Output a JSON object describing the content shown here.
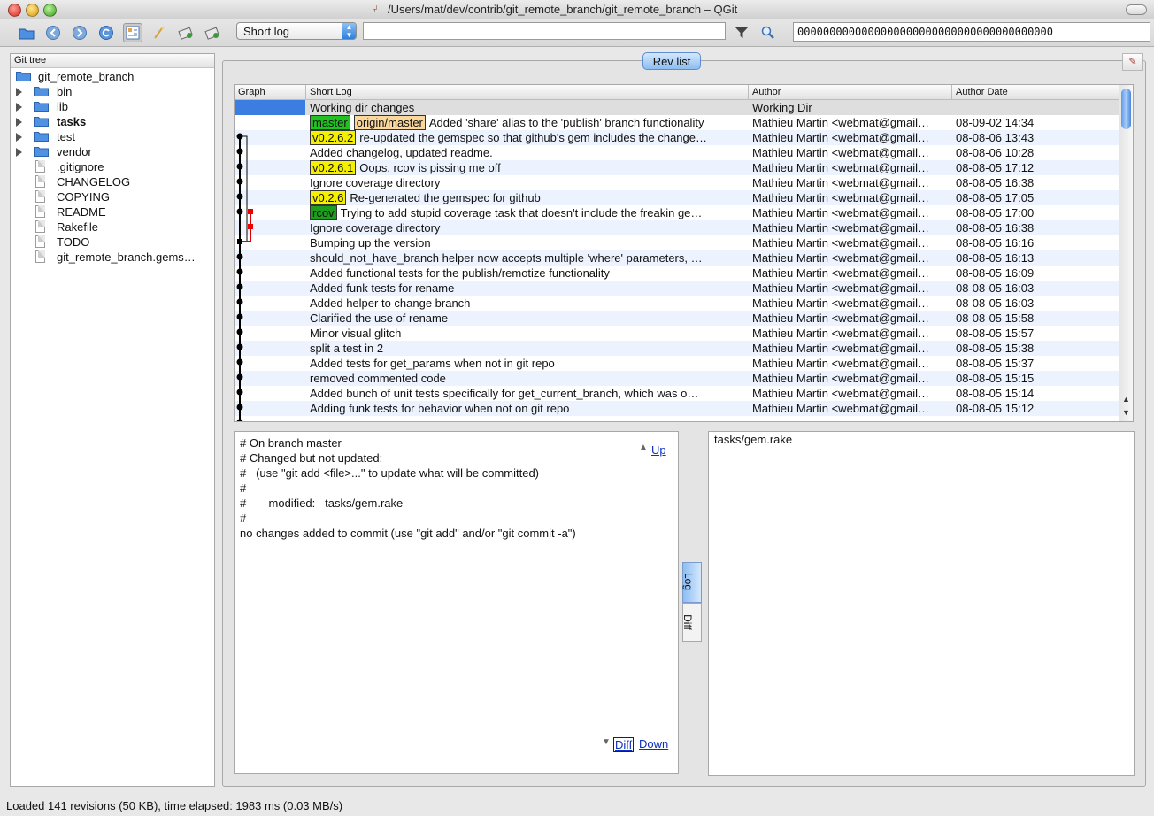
{
  "window": {
    "title": "/Users/mat/dev/contrib/git_remote_branch/git_remote_branch – QGit"
  },
  "toolbar": {
    "view_mode": "Short log",
    "filter_value": "",
    "sha_value": "0000000000000000000000000000000000000000"
  },
  "tree": {
    "header": "Git tree",
    "root": "git_remote_branch",
    "items": [
      {
        "label": "bin",
        "type": "folder",
        "bold": false
      },
      {
        "label": "lib",
        "type": "folder",
        "bold": false
      },
      {
        "label": "tasks",
        "type": "folder",
        "bold": true
      },
      {
        "label": "test",
        "type": "folder",
        "bold": false
      },
      {
        "label": "vendor",
        "type": "folder",
        "bold": false
      },
      {
        "label": ".gitignore",
        "type": "file",
        "bold": false
      },
      {
        "label": "CHANGELOG",
        "type": "file",
        "bold": false
      },
      {
        "label": "COPYING",
        "type": "file",
        "bold": false
      },
      {
        "label": "README",
        "type": "file",
        "bold": false
      },
      {
        "label": "Rakefile",
        "type": "file",
        "bold": false
      },
      {
        "label": "TODO",
        "type": "file",
        "bold": false
      },
      {
        "label": "git_remote_branch.gems…",
        "type": "file",
        "bold": false
      }
    ]
  },
  "revlist": {
    "tab_label": "Rev list",
    "columns": {
      "graph": "Graph",
      "log": "Short Log",
      "author": "Author",
      "date": "Author Date"
    },
    "rows": [
      {
        "tags": [],
        "log": "Working dir changes",
        "author": "Working Dir",
        "date": ""
      },
      {
        "tags": [
          {
            "text": "master",
            "color": "#22c122"
          },
          {
            "text": "origin/master",
            "color": "#f9d79d"
          }
        ],
        "log": "Added 'share' alias to the 'publish' branch functionality",
        "author": "Mathieu Martin <webmat@gmail…",
        "date": "08-09-02 14:34"
      },
      {
        "tags": [
          {
            "text": "v0.2.6.2",
            "color": "#f4f000"
          }
        ],
        "log": "re-updated the gemspec so that github's gem includes the change…",
        "author": "Mathieu Martin <webmat@gmail…",
        "date": "08-08-06 13:43"
      },
      {
        "tags": [],
        "log": "Added changelog, updated readme.",
        "author": "Mathieu Martin <webmat@gmail…",
        "date": "08-08-06 10:28"
      },
      {
        "tags": [
          {
            "text": "v0.2.6.1",
            "color": "#f4f000"
          }
        ],
        "log": "Oops, rcov is pissing me off",
        "author": "Mathieu Martin <webmat@gmail…",
        "date": "08-08-05 17:12"
      },
      {
        "tags": [],
        "log": "Ignore coverage directory",
        "author": "Mathieu Martin <webmat@gmail…",
        "date": "08-08-05 16:38"
      },
      {
        "tags": [
          {
            "text": "v0.2.6",
            "color": "#f4f000"
          }
        ],
        "log": "Re-generated the gemspec for github",
        "author": "Mathieu Martin <webmat@gmail…",
        "date": "08-08-05 17:05"
      },
      {
        "tags": [
          {
            "text": "rcov",
            "color": "#1e9c1e"
          }
        ],
        "log": "Trying to add stupid coverage task that doesn't include the freakin ge…",
        "author": "Mathieu Martin <webmat@gmail…",
        "date": "08-08-05 17:00"
      },
      {
        "tags": [],
        "log": "Ignore coverage directory",
        "author": "Mathieu Martin <webmat@gmail…",
        "date": "08-08-05 16:38"
      },
      {
        "tags": [],
        "log": "Bumping up the version",
        "author": "Mathieu Martin <webmat@gmail…",
        "date": "08-08-05 16:16"
      },
      {
        "tags": [],
        "log": "should_not_have_branch helper now accepts multiple 'where' parameters, …",
        "author": "Mathieu Martin <webmat@gmail…",
        "date": "08-08-05 16:13"
      },
      {
        "tags": [],
        "log": "Added functional tests for the publish/remotize functionality",
        "author": "Mathieu Martin <webmat@gmail…",
        "date": "08-08-05 16:09"
      },
      {
        "tags": [],
        "log": "Added funk tests for rename",
        "author": "Mathieu Martin <webmat@gmail…",
        "date": "08-08-05 16:03"
      },
      {
        "tags": [],
        "log": "Added helper to change branch",
        "author": "Mathieu Martin <webmat@gmail…",
        "date": "08-08-05 16:03"
      },
      {
        "tags": [],
        "log": "Clarified the use of rename",
        "author": "Mathieu Martin <webmat@gmail…",
        "date": "08-08-05 15:58"
      },
      {
        "tags": [],
        "log": "Minor visual glitch",
        "author": "Mathieu Martin <webmat@gmail…",
        "date": "08-08-05 15:57"
      },
      {
        "tags": [],
        "log": "split a test in 2",
        "author": "Mathieu Martin <webmat@gmail…",
        "date": "08-08-05 15:38"
      },
      {
        "tags": [],
        "log": "Added tests for get_params when not in git repo",
        "author": "Mathieu Martin <webmat@gmail…",
        "date": "08-08-05 15:37"
      },
      {
        "tags": [],
        "log": "removed commented code",
        "author": "Mathieu Martin <webmat@gmail…",
        "date": "08-08-05 15:15"
      },
      {
        "tags": [],
        "log": "Added bunch of unit tests specifically for get_current_branch, which was o…",
        "author": "Mathieu Martin <webmat@gmail…",
        "date": "08-08-05 15:14"
      },
      {
        "tags": [],
        "log": "Adding funk tests for behavior when not on git repo",
        "author": "Mathieu Martin <webmat@gmail…",
        "date": "08-08-05 15:12"
      }
    ]
  },
  "log_panel": {
    "lines": [
      "# On branch master",
      "# Changed but not updated:",
      "#   (use \"git add <file>...\" to update what will be committed)",
      "#",
      "#       modified:   tasks/gem.rake",
      "#",
      "no changes added to commit (use \"git add\" and/or \"git commit -a\")"
    ],
    "up_link": "Up",
    "diff_link": "Diff",
    "down_link": "Down"
  },
  "side_tabs": {
    "log": "Log",
    "diff": "Diff"
  },
  "diff_panel": {
    "file": "tasks/gem.rake"
  },
  "statusbar": {
    "text": "Loaded 141 revisions  (50 KB),   time elapsed: 1983 ms  (0.03 MB/s)"
  }
}
